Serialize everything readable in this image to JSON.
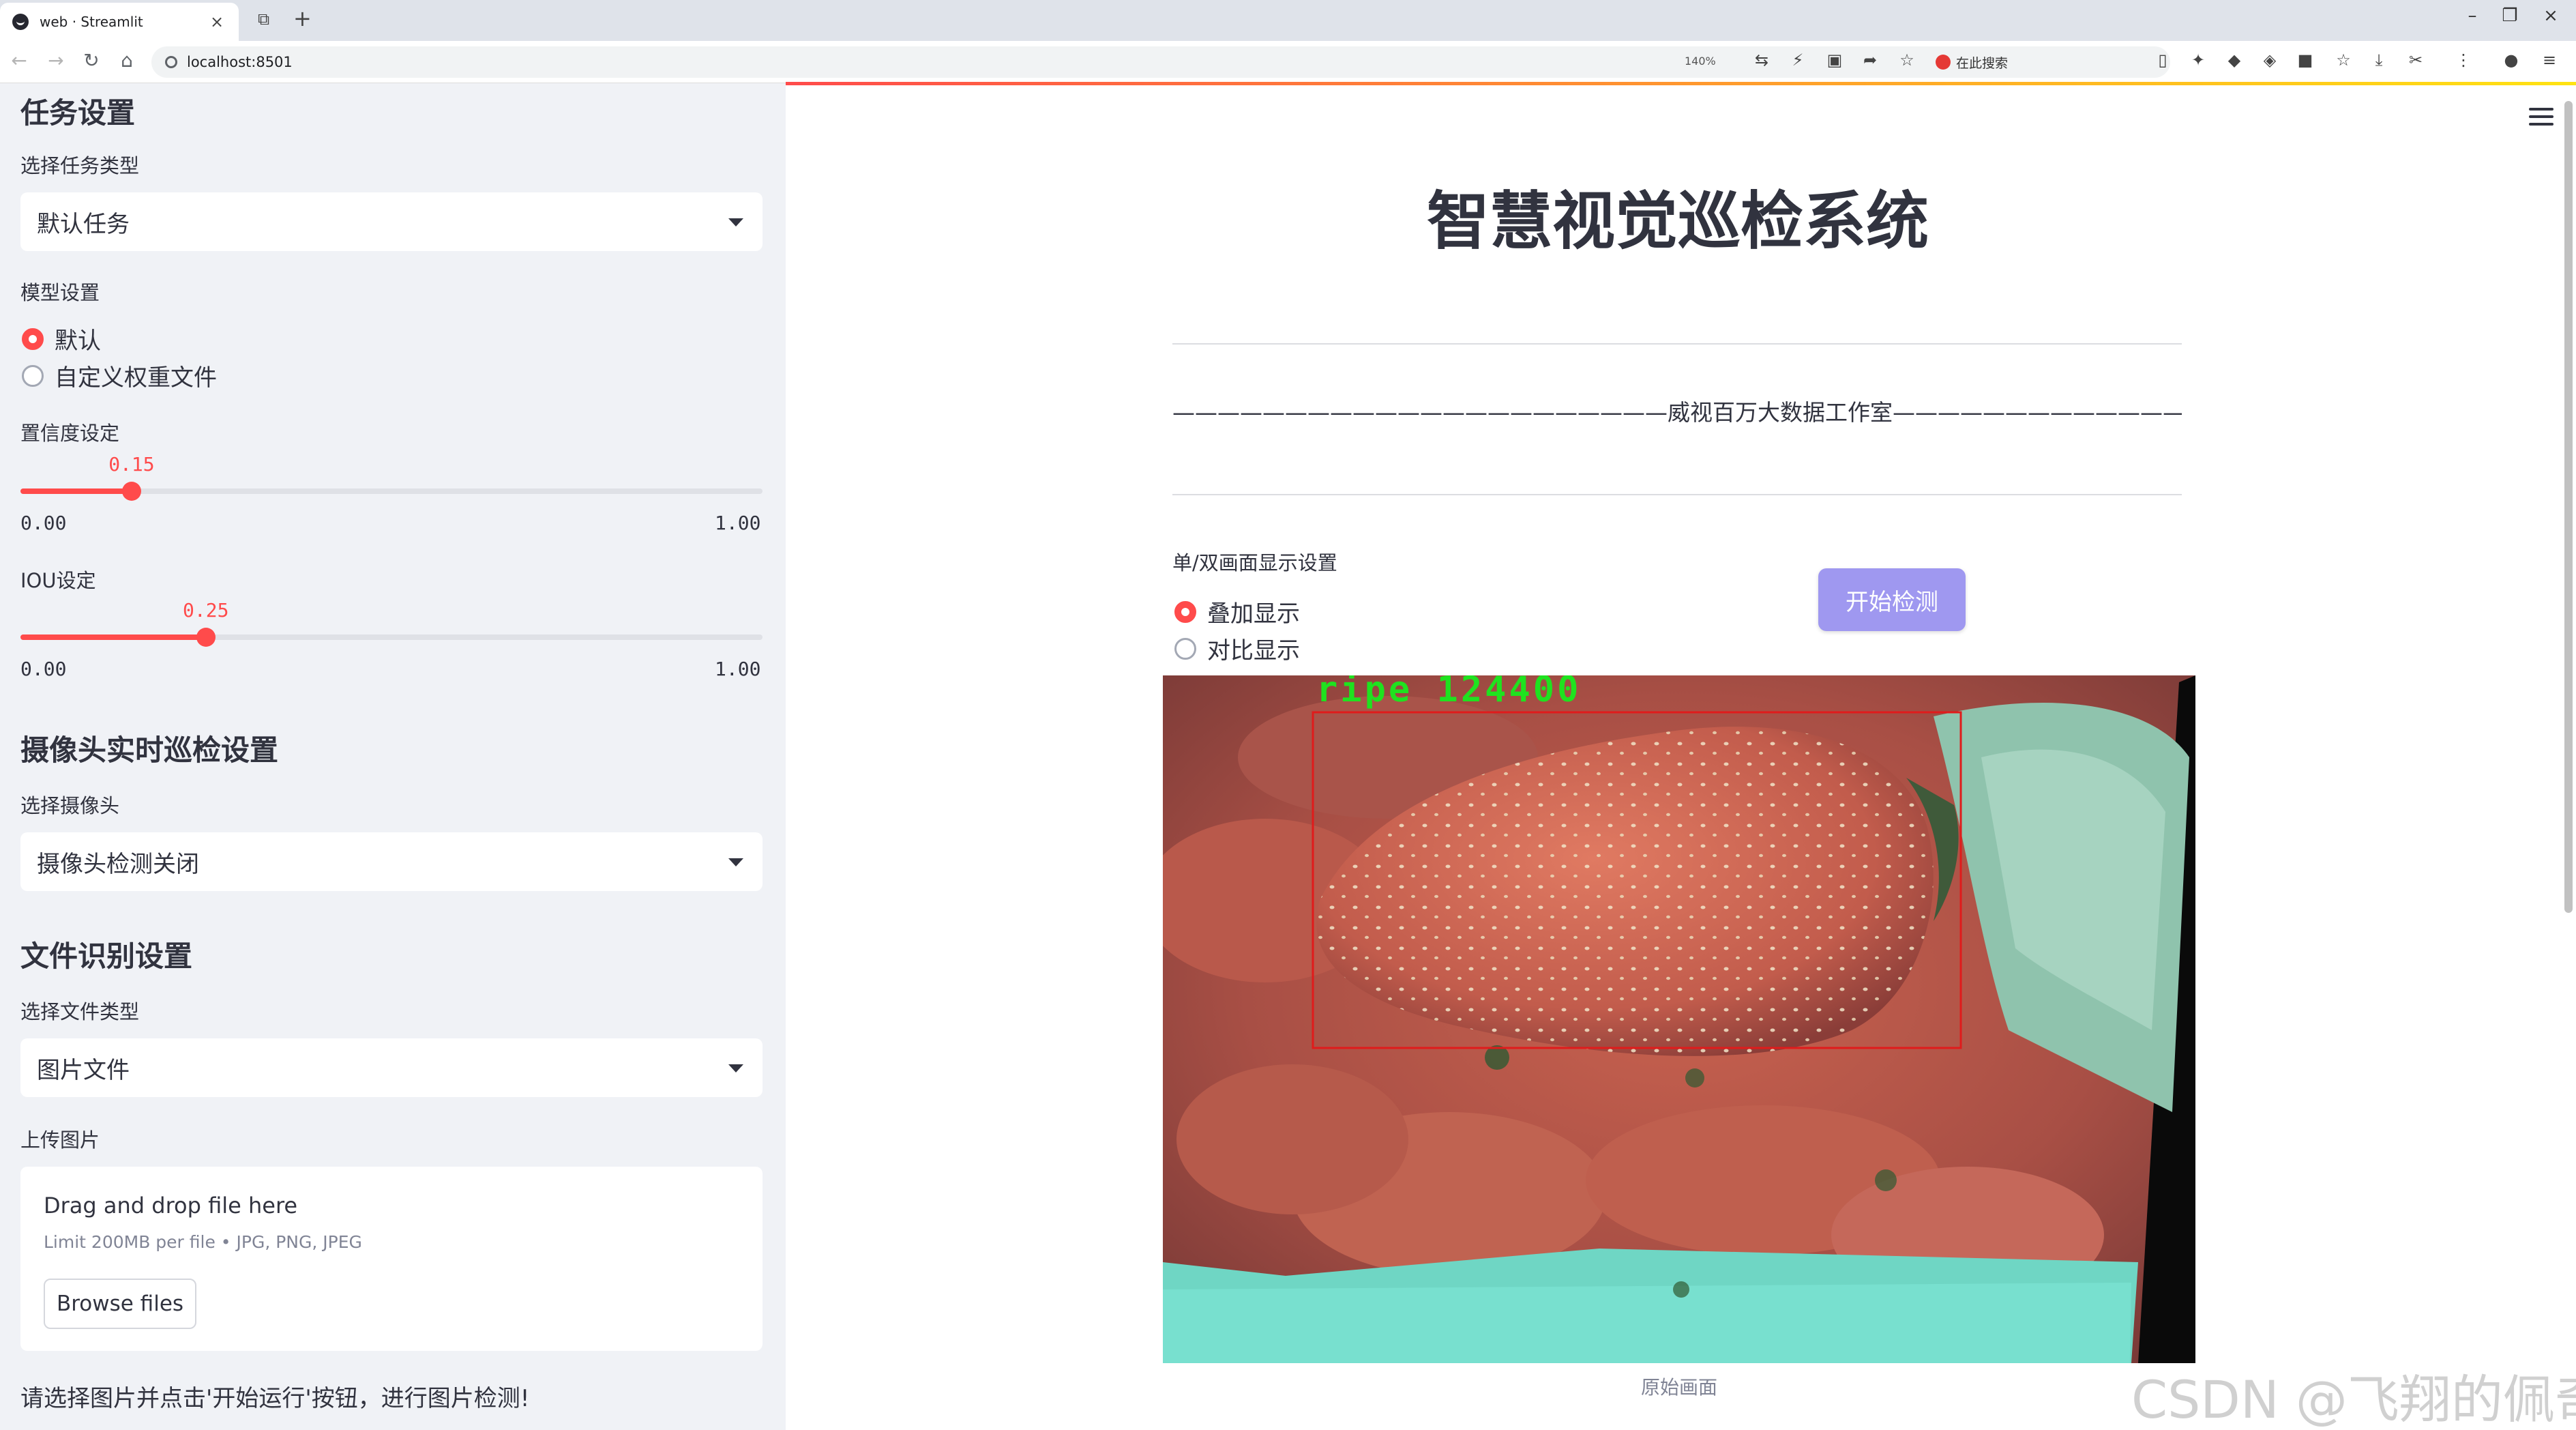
{
  "browser": {
    "tab_title": "web · Streamlit",
    "url": "localhost:8501",
    "zoom": "140%",
    "search_placeholder": "在此搜索",
    "accent": "#ff4b4b"
  },
  "sidebar": {
    "task_section": "任务设置",
    "task_type_label": "选择任务类型",
    "task_type_value": "默认任务",
    "model_label": "模型设置",
    "model_options": [
      "默认",
      "自定义权重文件"
    ],
    "confidence_label": "置信度设定",
    "confidence_value": 0.15,
    "confidence_text": "0.15",
    "iou_label": "IOU设定",
    "iou_value": 0.25,
    "iou_text": "0.25",
    "slider_min": "0.00",
    "slider_max": "1.00",
    "camera_section": "摄像头实时巡检设置",
    "camera_label": "选择摄像头",
    "camera_value": "摄像头检测关闭",
    "file_section": "文件识别设置",
    "file_type_label": "选择文件类型",
    "file_type_value": "图片文件",
    "upload_label": "上传图片",
    "upload_title": "Drag and drop file here",
    "upload_limit": "Limit 200MB per file • JPG, PNG, JPEG",
    "browse_button": "Browse files",
    "hint": "请选择图片并点击'开始运行'按钮，进行图片检测!"
  },
  "main": {
    "title": "智慧视觉巡检系统",
    "subtitle": "——————————————————————威视百万大数据工作室————————————————————————",
    "display_label": "单/双画面显示设置",
    "display_options": [
      "叠加显示",
      "对比显示"
    ],
    "start_button": "开始检测",
    "detection_label": "ripe  124400",
    "caption": "原始画面",
    "watermark": "CSDN @飞翔的佩奇",
    "box_color": "#e01b1b",
    "label_color": "#1fe21f",
    "button_color": "#9f98f0"
  }
}
